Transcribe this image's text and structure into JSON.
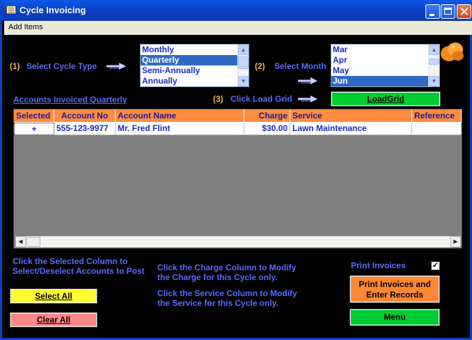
{
  "window": {
    "title": "Cycle Invoicing"
  },
  "menubar": {
    "items": [
      "Add Items"
    ]
  },
  "step1": {
    "number": "(1)",
    "label": "Select Cycle Type"
  },
  "cycle_types": {
    "items": [
      "Monthly",
      "Quarterly",
      "Semi-Annually",
      "Annually"
    ],
    "selected": "Quarterly"
  },
  "step2": {
    "number": "(2)",
    "label": "Select Month"
  },
  "months": {
    "items": [
      "Mar",
      "Apr",
      "May",
      "Jun"
    ],
    "selected": "Jun"
  },
  "step3": {
    "number": "(3)",
    "label": "Click Load Grid"
  },
  "load_grid_button": "LoadGrid",
  "accounts_link": "Accounts Invoiced Quarterly",
  "grid": {
    "columns": [
      "Selected",
      "Account No",
      "Account Name",
      "Charge",
      "Service",
      "Reference"
    ],
    "rows": [
      {
        "selected": "+",
        "account_no": "555-123-9977",
        "account_name": "Mr. Fred Flint",
        "charge": "$30.00",
        "service": "Lawn Maintenance",
        "reference": ""
      }
    ]
  },
  "notes": {
    "selected_col_1": "Click the Selected Column to",
    "selected_col_2": "Select/Deselect Accounts to Post",
    "charge_col_1": "Click the Charge Column to Modify",
    "charge_col_2": "the Charge for this Cycle only.",
    "service_col_1": "Click the Service Column to Modify",
    "service_col_2": "the Service for this Cycle only."
  },
  "buttons": {
    "select_all": "Select All",
    "clear_all": "Clear All",
    "print_line1": "Print Invoices and",
    "print_line2": "Enter Records",
    "menu": "Menu"
  },
  "print_invoices": {
    "label": "Print Invoices",
    "checked": true,
    "mark": "✓"
  },
  "colors": {
    "accent_label": "#5a6bff",
    "step_number": "#f0b060",
    "grid_header": "#ff8c40",
    "green_button": "#00cc33",
    "yellow_button": "#ffff33",
    "pink_button": "#ff8888",
    "orange_button": "#ff8833"
  }
}
